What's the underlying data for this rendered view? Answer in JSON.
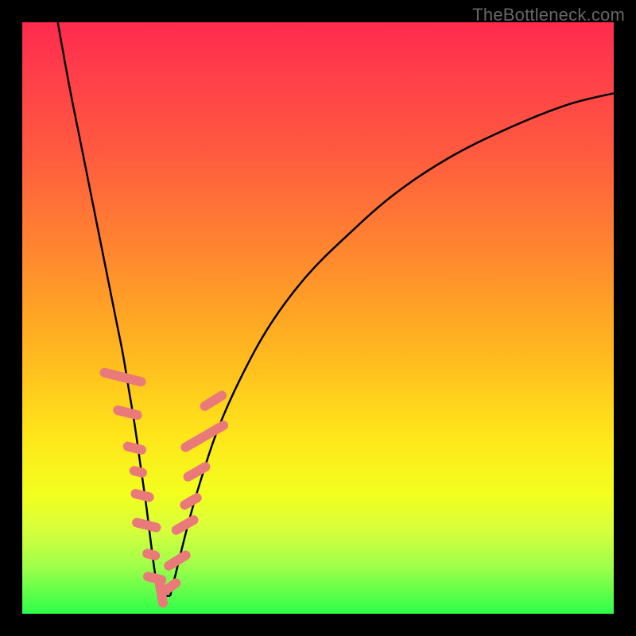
{
  "watermark": "TheBottleneck.com",
  "chart_data": {
    "type": "line",
    "title": "",
    "xlabel": "",
    "ylabel": "",
    "xlim": [
      0,
      100
    ],
    "ylim": [
      0,
      100
    ],
    "grid": false,
    "notes": "Colored background encodes bottleneck severity (red high, green low). The black V-shaped curve shows mismatch % for a given component pairing; bottom of the V is the balance point. Salmon-colored capsule markers cluster around the bottom of the V and along both arms near the base.",
    "series": [
      {
        "name": "left-arm",
        "x": [
          6,
          8,
          10,
          12,
          14,
          15,
          16,
          17,
          18,
          19,
          20,
          21,
          22,
          23
        ],
        "y": [
          100,
          89,
          79,
          69,
          59,
          54,
          49,
          44,
          38,
          32,
          25,
          18,
          10,
          3
        ]
      },
      {
        "name": "right-arm",
        "x": [
          25,
          26,
          28,
          30,
          33,
          37,
          42,
          48,
          55,
          63,
          72,
          82,
          92,
          100
        ],
        "y": [
          3,
          7,
          15,
          22,
          31,
          40,
          49,
          57,
          64,
          71,
          77,
          82,
          86,
          88
        ]
      }
    ],
    "flat_segment": {
      "x": [
        23,
        25
      ],
      "y": [
        3,
        3
      ]
    },
    "markers": [
      {
        "cx": 17.0,
        "cy": 40,
        "len": 8,
        "angle": -76
      },
      {
        "cx": 17.8,
        "cy": 34,
        "len": 5,
        "angle": -76
      },
      {
        "cx": 19.0,
        "cy": 28,
        "len": 4,
        "angle": -76
      },
      {
        "cx": 19.6,
        "cy": 24,
        "len": 3,
        "angle": -76
      },
      {
        "cx": 20.3,
        "cy": 20,
        "len": 4,
        "angle": -76
      },
      {
        "cx": 21.0,
        "cy": 15,
        "len": 5,
        "angle": -76
      },
      {
        "cx": 21.8,
        "cy": 10,
        "len": 3,
        "angle": -76
      },
      {
        "cx": 22.4,
        "cy": 6,
        "len": 4,
        "angle": -76
      },
      {
        "cx": 23.5,
        "cy": 3.5,
        "len": 5,
        "angle": -10
      },
      {
        "cx": 25.0,
        "cy": 4.5,
        "len": 4,
        "angle": 55
      },
      {
        "cx": 26.2,
        "cy": 9,
        "len": 5,
        "angle": 58
      },
      {
        "cx": 27.5,
        "cy": 15,
        "len": 5,
        "angle": 60
      },
      {
        "cx": 28.5,
        "cy": 19,
        "len": 4,
        "angle": 60
      },
      {
        "cx": 29.5,
        "cy": 24,
        "len": 5,
        "angle": 60
      },
      {
        "cx": 30.8,
        "cy": 30,
        "len": 9,
        "angle": 60
      },
      {
        "cx": 32.3,
        "cy": 36,
        "len": 5,
        "angle": 58
      }
    ],
    "marker_style": {
      "fill": "#ea7a7a",
      "rx": 6,
      "thickness": 12
    }
  }
}
